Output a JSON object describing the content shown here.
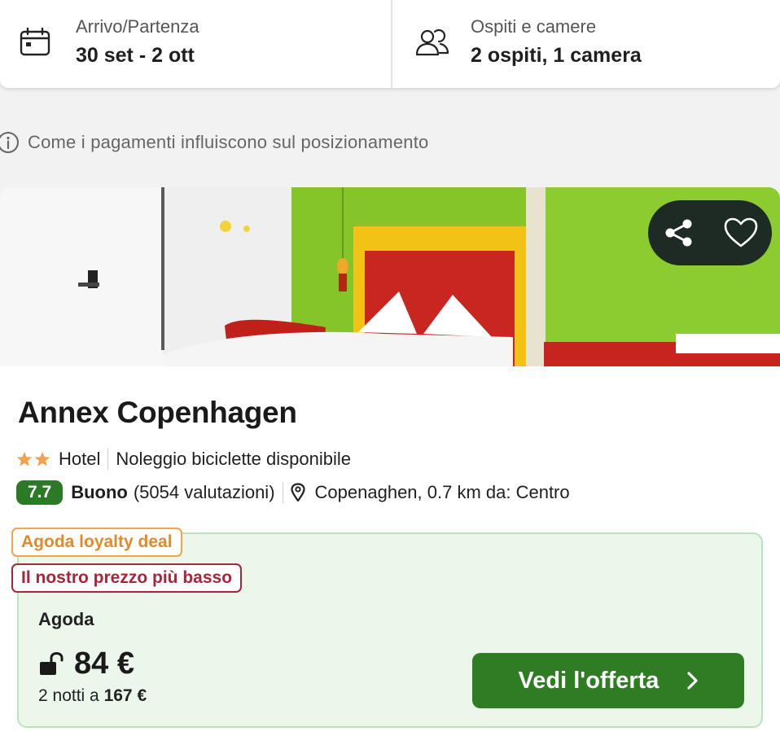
{
  "search_bar": {
    "dates": {
      "label": "Arrivo/Partenza",
      "value": "30 set - 2 ott",
      "icon": "calendar-icon"
    },
    "guests": {
      "label": "Ospiti e camere",
      "value": "2 ospiti, 1 camera",
      "icon": "users-icon"
    }
  },
  "payments_note": {
    "icon": "info-icon",
    "text": "Come i pagamenti influiscono sul posizionamento"
  },
  "hotel": {
    "name": "Annex Copenhagen",
    "stars": 2,
    "type": "Hotel",
    "amenity": "Noleggio biciclette disponibile",
    "score": "7.7",
    "rating_word": "Buono",
    "reviews": "(5054 valutazioni)",
    "location": "Copenaghen, 0.7 km da: Centro",
    "photo_actions": {
      "share_icon": "share-icon",
      "favorite_icon": "heart-icon"
    }
  },
  "deal": {
    "loyalty_tag": "Agoda loyalty deal",
    "lowest_tag": "Il nostro prezzo più basso",
    "provider": "Agoda",
    "price": "84 €",
    "total_prefix": "2 notti a",
    "total_price": "167 €",
    "cta": "Vedi l'offerta"
  },
  "colors": {
    "score_badge": "#2b7a26",
    "cta_bg": "#2e7d23",
    "deal_bg": "#eaf7ea",
    "deal_border": "#b9e3b9",
    "loyalty_tag": "#e4892a",
    "lowest_tag": "#a8253c",
    "stars": "#f5a04a"
  }
}
